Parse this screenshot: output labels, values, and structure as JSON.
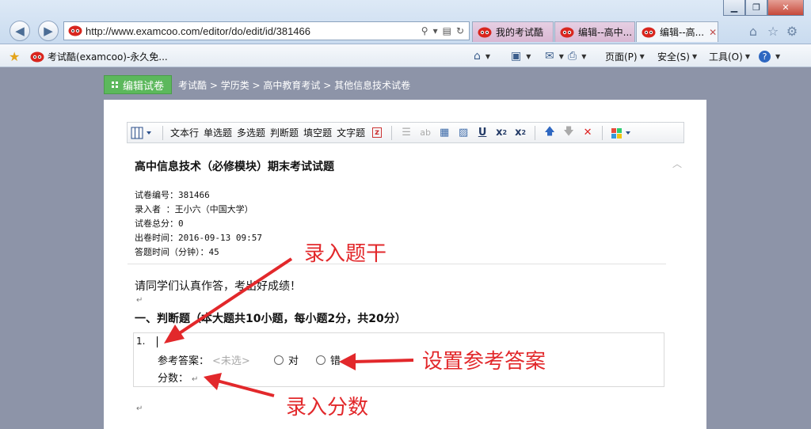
{
  "browser": {
    "url": "http://www.examcoo.com/editor/do/edit/id/381466",
    "tabs": [
      {
        "label": "我的考试酷",
        "active": false
      },
      {
        "label": "编辑--高中...",
        "active": false
      },
      {
        "label": "编辑--高...",
        "active": true
      }
    ],
    "favorites_link": "考试酷(examcoo)-永久免...",
    "commands": {
      "page": "页面(P)",
      "safety": "安全(S)",
      "tools": "工具(O)"
    }
  },
  "page": {
    "edit_button": "编辑试卷",
    "breadcrumb": "考试酷 > 学历类 > 高中教育考试 > 其他信息技术试卷"
  },
  "editor_toolbar": {
    "buttons": [
      "文本行",
      "单选题",
      "多选题",
      "判断题",
      "填空题",
      "文字题"
    ]
  },
  "paper": {
    "title": "高中信息技术（必修模块）期末考试试题",
    "meta": [
      "试卷编号：381466",
      "录入者  ：王小六（中国大学）",
      "试卷总分：0",
      "出卷时间：2016-09-13 09:57",
      "答题时间（分钟）：45"
    ],
    "instructions": "请同学们认真作答，考出好成绩！",
    "paragraph_mark": "↵",
    "section_title": "一、判断题（本大题共10小题，每小题2分，共20分）",
    "question": {
      "number": "1.",
      "ref_label": "参考答案：",
      "ref_placeholder": "<未选>",
      "option_true": "对",
      "option_false": "错",
      "score_label": "分数："
    }
  },
  "annotations": {
    "stem": "录入题干",
    "answer": "设置参考答案",
    "score": "录入分数"
  },
  "colors": {
    "page_bg": "#8d94a8",
    "edit_button": "#5cb85c",
    "annotation": "#e2282b"
  }
}
